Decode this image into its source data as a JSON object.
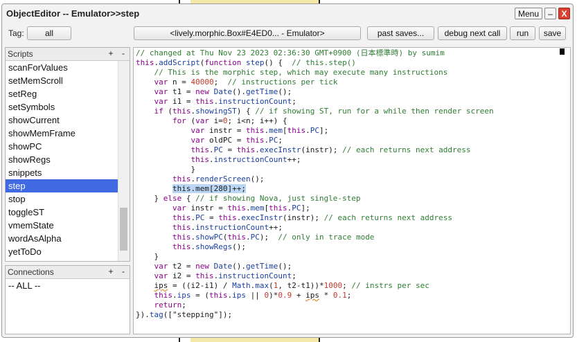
{
  "window": {
    "title": "ObjectEditor -- Emulator>>step",
    "menu_label": "Menu",
    "minimize_label": "–",
    "close_label": "X"
  },
  "toolbar": {
    "tag_label": "Tag:",
    "tag_value": "all",
    "target_label": "<lively.morphic.Box#E4ED0... - Emulator>",
    "past_saves_label": "past saves...",
    "debug_label": "debug next call",
    "run_label": "run",
    "save_label": "save"
  },
  "scripts_pane": {
    "title": "Scripts",
    "add_label": "+",
    "remove_label": "-",
    "items": [
      {
        "label": "scanForValues",
        "selected": false
      },
      {
        "label": "setMemScroll",
        "selected": false
      },
      {
        "label": "setReg",
        "selected": false
      },
      {
        "label": "setSymbols",
        "selected": false
      },
      {
        "label": "showCurrent",
        "selected": false
      },
      {
        "label": "showMemFrame",
        "selected": false
      },
      {
        "label": "showPC",
        "selected": false
      },
      {
        "label": "showRegs",
        "selected": false
      },
      {
        "label": "snippets",
        "selected": false
      },
      {
        "label": "step",
        "selected": true
      },
      {
        "label": "stop",
        "selected": false
      },
      {
        "label": "toggleST",
        "selected": false
      },
      {
        "label": "vmemState",
        "selected": false
      },
      {
        "label": "wordAsAlpha",
        "selected": false
      },
      {
        "label": "yetToDo",
        "selected": false
      }
    ]
  },
  "connections_pane": {
    "title": "Connections",
    "add_label": "+",
    "remove_label": "-",
    "items": [
      {
        "label": "-- ALL --"
      }
    ]
  },
  "editor": {
    "lines": [
      [
        [
          "cm",
          "// changed at Thu Nov 23 2023 02:36:30 GMT+0900 (日本標準時) by sumim"
        ]
      ],
      [
        [
          "kw",
          "this"
        ],
        [
          "",
          "."
        ],
        [
          "fn",
          "addScript"
        ],
        [
          "",
          "("
        ],
        [
          "kw",
          "function"
        ],
        [
          "",
          " "
        ],
        [
          "fn",
          "step"
        ],
        [
          "",
          "() {  "
        ],
        [
          "cm",
          "// this.step()"
        ]
      ],
      [
        [
          "",
          "    "
        ],
        [
          "cm",
          "// This is the morphic step, which may execute many instructions"
        ]
      ],
      [
        [
          "",
          "    "
        ],
        [
          "kw",
          "var"
        ],
        [
          "",
          " n = "
        ],
        [
          "nm",
          "40000"
        ],
        [
          "",
          ";  "
        ],
        [
          "cm",
          "// instructions per tick"
        ]
      ],
      [
        [
          "",
          "    "
        ],
        [
          "kw",
          "var"
        ],
        [
          "",
          " t1 = "
        ],
        [
          "kw",
          "new"
        ],
        [
          "",
          " "
        ],
        [
          "fn",
          "Date"
        ],
        [
          "",
          "()."
        ],
        [
          "fn",
          "getTime"
        ],
        [
          "",
          "();"
        ]
      ],
      [
        [
          "",
          "    "
        ],
        [
          "kw",
          "var"
        ],
        [
          "",
          " i1 = "
        ],
        [
          "kw",
          "this"
        ],
        [
          "",
          "."
        ],
        [
          "fn",
          "instructionCount"
        ],
        [
          "",
          ";"
        ]
      ],
      [
        [
          "",
          "    "
        ],
        [
          "kw",
          "if"
        ],
        [
          "",
          " ("
        ],
        [
          "kw",
          "this"
        ],
        [
          "",
          "."
        ],
        [
          "fn",
          "showingST"
        ],
        [
          "",
          ") { "
        ],
        [
          "cm",
          "// if showing ST, run for a while then render screen"
        ]
      ],
      [
        [
          "",
          "        "
        ],
        [
          "kw",
          "for"
        ],
        [
          "",
          " ("
        ],
        [
          "kw",
          "var"
        ],
        [
          "",
          " i="
        ],
        [
          "nm",
          "0"
        ],
        [
          "",
          "; i<n; i++) {"
        ]
      ],
      [
        [
          "",
          "            "
        ],
        [
          "kw",
          "var"
        ],
        [
          "",
          " instr = "
        ],
        [
          "kw",
          "this"
        ],
        [
          "",
          "."
        ],
        [
          "fn",
          "mem"
        ],
        [
          "",
          "["
        ],
        [
          "kw",
          "this"
        ],
        [
          "",
          "."
        ],
        [
          "fn",
          "PC"
        ],
        [
          "",
          "];"
        ]
      ],
      [
        [
          "",
          "            "
        ],
        [
          "kw",
          "var"
        ],
        [
          "",
          " oldPC = "
        ],
        [
          "kw",
          "this"
        ],
        [
          "",
          "."
        ],
        [
          "fn",
          "PC"
        ],
        [
          "",
          ";"
        ]
      ],
      [
        [
          "",
          "            "
        ],
        [
          "kw",
          "this"
        ],
        [
          "",
          "."
        ],
        [
          "fn",
          "PC"
        ],
        [
          "",
          " = "
        ],
        [
          "kw",
          "this"
        ],
        [
          "",
          "."
        ],
        [
          "fn",
          "execInstr"
        ],
        [
          "",
          "(instr); "
        ],
        [
          "cm",
          "// each returns next address"
        ]
      ],
      [
        [
          "",
          "            "
        ],
        [
          "kw",
          "this"
        ],
        [
          "",
          "."
        ],
        [
          "fn",
          "instructionCount"
        ],
        [
          "",
          "++;"
        ]
      ],
      [
        [
          "",
          "            }"
        ]
      ],
      [
        [
          "",
          "        "
        ],
        [
          "kw",
          "this"
        ],
        [
          "",
          "."
        ],
        [
          "fn",
          "renderScreen"
        ],
        [
          "",
          "();"
        ]
      ],
      [
        [
          "",
          "        "
        ],
        [
          "hl",
          "this.mem[280]++;"
        ]
      ],
      [
        [
          "",
          "    } "
        ],
        [
          "kw",
          "else"
        ],
        [
          "",
          " { "
        ],
        [
          "cm",
          "// if showing Nova, just single-step"
        ]
      ],
      [
        [
          "",
          "        "
        ],
        [
          "kw",
          "var"
        ],
        [
          "",
          " instr = "
        ],
        [
          "kw",
          "this"
        ],
        [
          "",
          "."
        ],
        [
          "fn",
          "mem"
        ],
        [
          "",
          "["
        ],
        [
          "kw",
          "this"
        ],
        [
          "",
          "."
        ],
        [
          "fn",
          "PC"
        ],
        [
          "",
          "];"
        ]
      ],
      [
        [
          "",
          "        "
        ],
        [
          "kw",
          "this"
        ],
        [
          "",
          "."
        ],
        [
          "fn",
          "PC"
        ],
        [
          "",
          " = "
        ],
        [
          "kw",
          "this"
        ],
        [
          "",
          "."
        ],
        [
          "fn",
          "execInstr"
        ],
        [
          "",
          "(instr); "
        ],
        [
          "cm",
          "// each returns next address"
        ]
      ],
      [
        [
          "",
          "        "
        ],
        [
          "kw",
          "this"
        ],
        [
          "",
          "."
        ],
        [
          "fn",
          "instructionCount"
        ],
        [
          "",
          "++;"
        ]
      ],
      [
        [
          "",
          "        "
        ],
        [
          "kw",
          "this"
        ],
        [
          "",
          "."
        ],
        [
          "fn",
          "showPC"
        ],
        [
          "",
          "("
        ],
        [
          "kw",
          "this"
        ],
        [
          "",
          "."
        ],
        [
          "fn",
          "PC"
        ],
        [
          "",
          ");  "
        ],
        [
          "cm",
          "// only in trace mode"
        ]
      ],
      [
        [
          "",
          "        "
        ],
        [
          "kw",
          "this"
        ],
        [
          "",
          "."
        ],
        [
          "fn",
          "showRegs"
        ],
        [
          "",
          "();"
        ]
      ],
      [
        [
          "",
          "    }"
        ]
      ],
      [
        [
          "",
          "    "
        ],
        [
          "kw",
          "var"
        ],
        [
          "",
          " t2 = "
        ],
        [
          "kw",
          "new"
        ],
        [
          "",
          " "
        ],
        [
          "fn",
          "Date"
        ],
        [
          "",
          "()."
        ],
        [
          "fn",
          "getTime"
        ],
        [
          "",
          "();"
        ]
      ],
      [
        [
          "",
          "    "
        ],
        [
          "kw",
          "var"
        ],
        [
          "",
          " i2 = "
        ],
        [
          "kw",
          "this"
        ],
        [
          "",
          "."
        ],
        [
          "fn",
          "instructionCount"
        ],
        [
          "",
          ";"
        ]
      ],
      [
        [
          "",
          "    "
        ],
        [
          "sq",
          "ips"
        ],
        [
          "",
          " = ((i2-i1) / "
        ],
        [
          "fn",
          "Math"
        ],
        [
          "",
          "."
        ],
        [
          "fn",
          "max"
        ],
        [
          "",
          "("
        ],
        [
          "nm",
          "1"
        ],
        [
          "",
          ", t2-t1))*"
        ],
        [
          "nm",
          "1000"
        ],
        [
          "",
          "; "
        ],
        [
          "cm",
          "// instrs per sec"
        ]
      ],
      [
        [
          "",
          "    "
        ],
        [
          "kw",
          "this"
        ],
        [
          "",
          "."
        ],
        [
          "fn",
          "ips"
        ],
        [
          "",
          " = ("
        ],
        [
          "kw",
          "this"
        ],
        [
          "",
          "."
        ],
        [
          "fn",
          "ips"
        ],
        [
          "",
          " || "
        ],
        [
          "nm",
          "0"
        ],
        [
          "",
          ")*"
        ],
        [
          "nm",
          "0.9"
        ],
        [
          "",
          " + "
        ],
        [
          "sq",
          "ips"
        ],
        [
          "",
          " * "
        ],
        [
          "nm",
          "0.1"
        ],
        [
          "",
          ";"
        ]
      ],
      [
        [
          "",
          "    "
        ],
        [
          "kw",
          "return"
        ],
        [
          "",
          ";"
        ]
      ],
      [
        [
          "",
          "})."
        ],
        [
          "fn",
          "tag"
        ],
        [
          "",
          "([\"stepping\"]);"
        ]
      ]
    ]
  }
}
